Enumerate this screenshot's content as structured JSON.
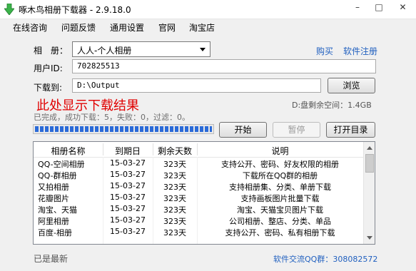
{
  "window": {
    "title": "啄木鸟相册下载器 - 2.9.18.0",
    "icon": "green-down-arrow-icon"
  },
  "menu": [
    "在线咨询",
    "问题反馈",
    "通用设置",
    "官网",
    "淘宝店"
  ],
  "form": {
    "album_label": "相　册：",
    "album_selected": "人人-个人相册",
    "buy_link": "购买",
    "register_link": "软件注册",
    "user_id_label": "用户ID:",
    "user_id_value": "702825513",
    "download_to_label": "下载到:",
    "download_path": "D:\\Output",
    "browse_button": "浏览"
  },
  "status": {
    "result_text": "此处显示下载结果",
    "stats_text": "已完成，成功下载：5，失败：0，过滤：0。",
    "disk_space": "D:盘剩余空间：1.4GB",
    "progress": 1.0
  },
  "buttons": {
    "start": "开始",
    "pause": "暂停",
    "open_dir": "打开目录"
  },
  "table": {
    "headers": [
      "相册名称",
      "到期日",
      "剩余天数",
      "说明"
    ],
    "rows": [
      [
        "QQ-空间相册",
        "15-03-27",
        "323天",
        "支持公开、密码、好友权限的相册"
      ],
      [
        "QQ-群相册",
        "15-03-27",
        "323天",
        "下载所在QQ群的相册"
      ],
      [
        "又拍相册",
        "15-03-27",
        "323天",
        "支持相册集、分类、单册下载"
      ],
      [
        "花瓣图片",
        "15-03-27",
        "323天",
        "支持画板图片批量下载"
      ],
      [
        "淘宝、天猫",
        "15-03-27",
        "323天",
        "淘宝、天猫宝贝图片下载"
      ],
      [
        "阿里相册",
        "15-03-27",
        "323天",
        "公司相册、整店、分类、单品"
      ],
      [
        "百度-相册",
        "15-03-27",
        "323天",
        "支持公开、密码、私有相册下载"
      ]
    ]
  },
  "footer": {
    "left": "已是最新",
    "qq_label": "软件交流QQ群：",
    "qq_number": "308082572"
  },
  "colors": {
    "accent": "#1f5fbf",
    "result": "#e00000",
    "progress": "#2a6ad8"
  }
}
